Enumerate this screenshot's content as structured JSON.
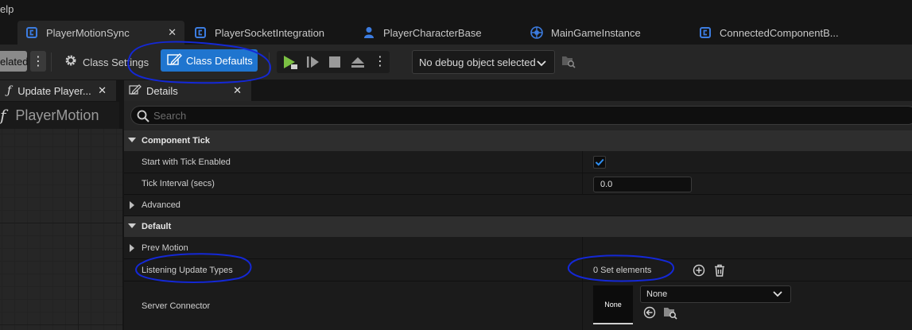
{
  "menu": {
    "help_fragment": "elp"
  },
  "tabs": [
    {
      "label": "PlayerMotionSync",
      "icon": "blueprint-class-icon",
      "active": true,
      "close": "✕"
    },
    {
      "label": "PlayerSocketIntegration",
      "icon": "blueprint-class-icon"
    },
    {
      "label": "PlayerCharacterBase",
      "icon": "character-icon"
    },
    {
      "label": "MainGameInstance",
      "icon": "game-instance-icon"
    },
    {
      "label": "ConnectedComponentB...",
      "icon": "blueprint-class-icon"
    }
  ],
  "toolbar": {
    "compile_status": "elated",
    "class_settings": "Class Settings",
    "class_defaults": "Class Defaults",
    "debug_object": "No debug object selected"
  },
  "left_panel": {
    "tab_label": "Update Player...",
    "header": "PlayerMotion"
  },
  "details": {
    "tab_label": "Details",
    "search_placeholder": "Search",
    "categories": {
      "component_tick": "Component Tick",
      "default": "Default"
    },
    "rows": {
      "start_with_tick": {
        "label": "Start with Tick Enabled",
        "checked": true
      },
      "tick_interval": {
        "label": "Tick Interval (secs)",
        "value": "0.0"
      },
      "advanced": {
        "label": "Advanced"
      },
      "prev_motion": {
        "label": "Prev Motion"
      },
      "listening_update_types": {
        "label": "Listening Update Types",
        "value": "0 Set elements"
      },
      "server_connector": {
        "label": "Server Connector",
        "thumb": "None",
        "selected": "None"
      }
    }
  },
  "colors": {
    "accent": "#1f75cf",
    "annotation": "#1428d6",
    "play_green": "#7bc043"
  },
  "close_glyph": "✕"
}
